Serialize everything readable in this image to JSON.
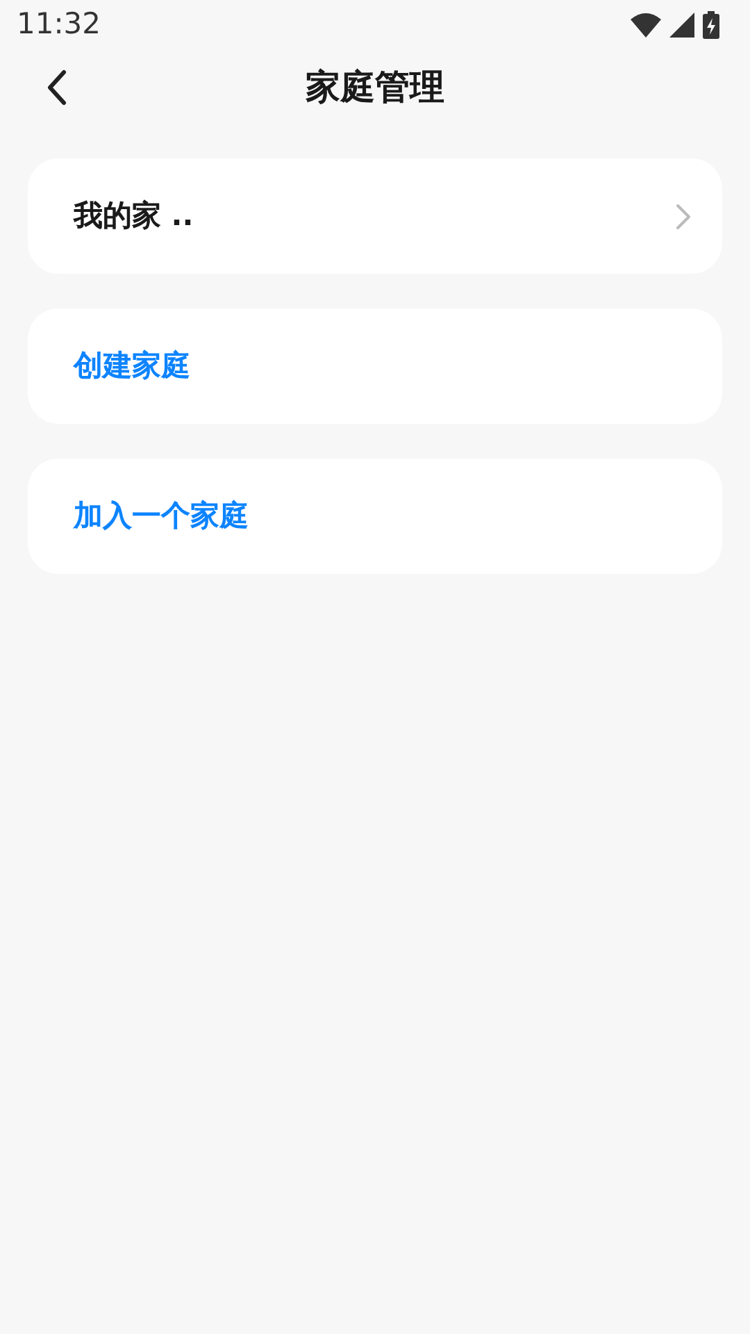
{
  "status_bar": {
    "time": "11:32"
  },
  "header": {
    "title": "家庭管理"
  },
  "items": [
    {
      "kind": "nav",
      "label": "我的家 .."
    },
    {
      "kind": "action",
      "label": "创建家庭"
    },
    {
      "kind": "action",
      "label": "加入一个家庭"
    }
  ]
}
